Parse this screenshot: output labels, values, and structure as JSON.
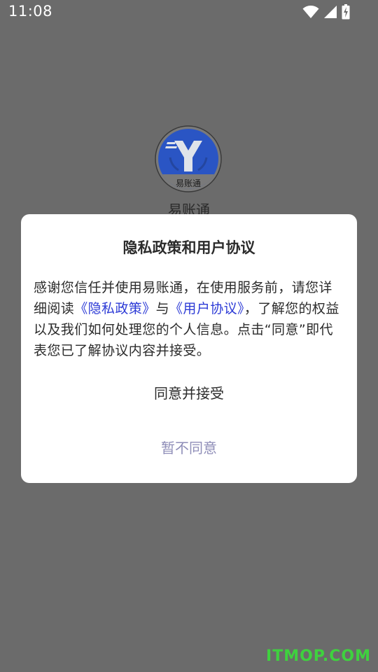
{
  "status_bar": {
    "time": "11:08",
    "icons": [
      "wifi-icon",
      "cellular-signal-icon",
      "battery-charging-icon"
    ]
  },
  "splash": {
    "logo_caption": "易账通",
    "app_name": "易账通"
  },
  "dialog": {
    "title": "隐私政策和用户协议",
    "body_part1": "感谢您信任并使用易账通，在使用服务前，请您详细阅读",
    "privacy_link": "《隐私政策》",
    "body_and": "与",
    "terms_link": "《用户协议》",
    "body_part2": "，了解您的权益以及我们如何处理您的个人信息。点击“同意”即代表您已了解协议内容并接受。",
    "agree_label": "同意并接受",
    "disagree_label": "暂不同意"
  },
  "watermark": "ITMOP.COM",
  "colors": {
    "overlay": "#6b6b6b",
    "link": "#2d3bd6",
    "disagree": "#8f8eb8",
    "logo_blue": "#2a55c4",
    "watermark": "#3fd13f"
  }
}
